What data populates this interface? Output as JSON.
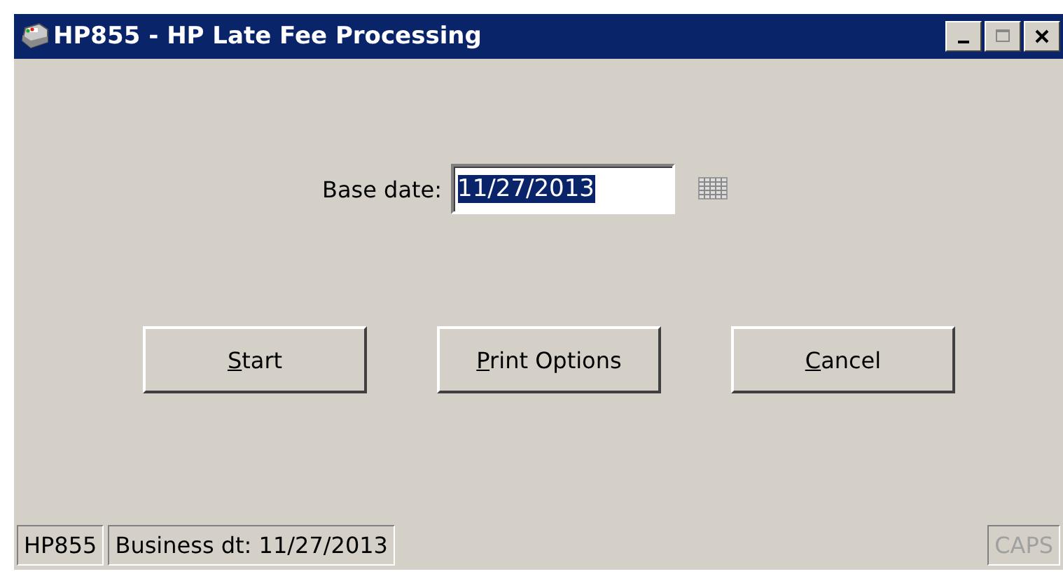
{
  "window": {
    "title": "HP855 - HP Late Fee Processing"
  },
  "base_date": {
    "label": "Base date:",
    "value": "11/27/2013",
    "selected": true
  },
  "buttons": [
    {
      "label": "Start",
      "first_letter_underlined": true
    },
    {
      "label": "Print Options",
      "first_letter_underlined": true
    },
    {
      "label": "Cancel",
      "first_letter_underlined": true
    }
  ],
  "status_bar": {
    "panels": [
      "HP855",
      "Business dt: 11/27/2013"
    ],
    "caps": {
      "label": "CAPS",
      "on": false
    }
  }
}
